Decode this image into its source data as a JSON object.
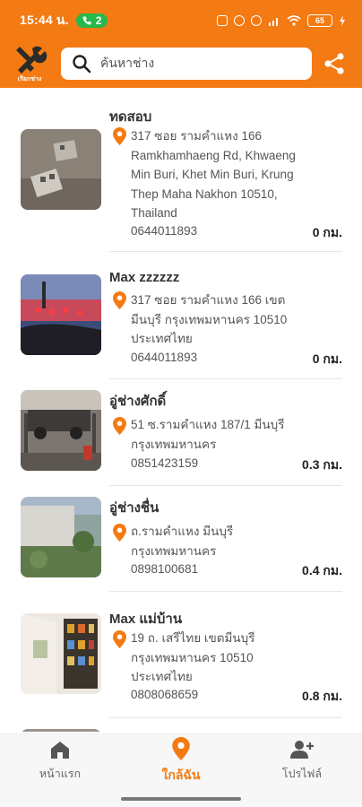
{
  "status_bar": {
    "time": "15:44 น.",
    "notification_count": "2",
    "battery": "65"
  },
  "app_bar": {
    "logo_text": "เรียกช่าง",
    "search_placeholder": "ค้นหาช่าง"
  },
  "shops": [
    {
      "name": "ทดสอบ",
      "address": "317 ซอย รามคำแหง 166 Ramkhamhaeng Rd, Khwaeng Min Buri, Khet Min Buri, Krung Thep Maha Nakhon 10510, Thailand",
      "phone": "0644011893",
      "distance": "0 กม."
    },
    {
      "name": "Max zzzzzz",
      "address": "317 ซอย รามคำแหง 166 เขต มีนบุรี กรุงเทพมหานคร 10510 ประเทศไทย",
      "phone": "0644011893",
      "distance": "0 กม."
    },
    {
      "name": "อู่ช่างศักดิ์",
      "address": "51 ซ.รามคำแหง 187/1 มีนบุรี กรุงเทพมหานคร",
      "phone": "0851423159",
      "distance": "0.3 กม."
    },
    {
      "name": "อู่ช่างชื่น",
      "address": "ถ.รามคำแหง มีนบุรี กรุงเทพมหานคร",
      "phone": "0898100681",
      "distance": "0.4 กม."
    },
    {
      "name": "Max แม่บ้าน",
      "address": "19 ถ. เสรีไทย เขตมีนบุรี กรุงเทพมหานคร 10510 ประเทศไทย",
      "phone": "0808068659",
      "distance": "0.8 กม."
    }
  ],
  "bottom_nav": {
    "home": "หน้าแรก",
    "nearby": "ใกล้ฉัน",
    "profile": "โปรไฟล์",
    "active": "nearby"
  },
  "colors": {
    "brand": "#f47a13",
    "status_pill": "#27b84a"
  }
}
